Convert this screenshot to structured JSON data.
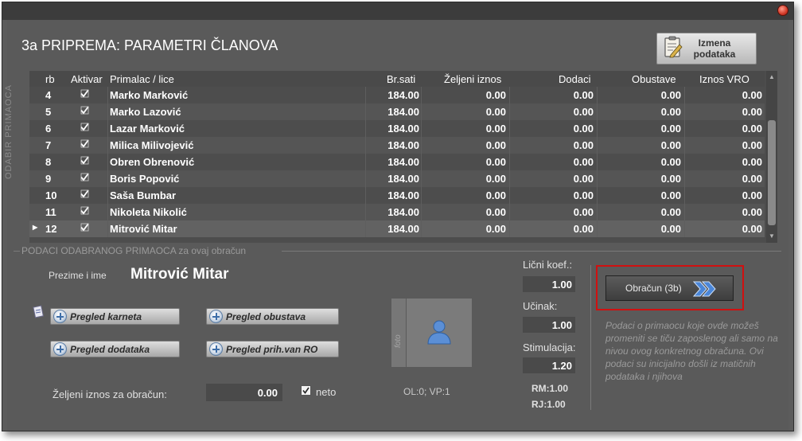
{
  "window": {
    "title": "3a PRIPREMA: PARAMETRI ČLANOVA"
  },
  "toolbar": {
    "edit_button_line1": "Izmena",
    "edit_button_line2": "podataka"
  },
  "grid": {
    "side_label": "ODABIR PRIMAOCA",
    "columns": [
      "rb",
      "Aktivar",
      "Primalac / lice",
      "Br.sati",
      "Željeni iznos",
      "Dodaci",
      "Obustave",
      "Iznos VRO"
    ],
    "rows": [
      {
        "rb": "4",
        "name": "Marko Marković",
        "sati": "184.00",
        "zeljeni": "0.00",
        "dodaci": "0.00",
        "obustave": "0.00",
        "vro": "0.00"
      },
      {
        "rb": "5",
        "name": "Marko Lazović",
        "sati": "184.00",
        "zeljeni": "0.00",
        "dodaci": "0.00",
        "obustave": "0.00",
        "vro": "0.00"
      },
      {
        "rb": "6",
        "name": "Lazar Marković",
        "sati": "184.00",
        "zeljeni": "0.00",
        "dodaci": "0.00",
        "obustave": "0.00",
        "vro": "0.00"
      },
      {
        "rb": "7",
        "name": "Milica Milivojević",
        "sati": "184.00",
        "zeljeni": "0.00",
        "dodaci": "0.00",
        "obustave": "0.00",
        "vro": "0.00"
      },
      {
        "rb": "8",
        "name": "Obren Obrenović",
        "sati": "184.00",
        "zeljeni": "0.00",
        "dodaci": "0.00",
        "obustave": "0.00",
        "vro": "0.00"
      },
      {
        "rb": "9",
        "name": "Boris Popović",
        "sati": "184.00",
        "zeljeni": "0.00",
        "dodaci": "0.00",
        "obustave": "0.00",
        "vro": "0.00"
      },
      {
        "rb": "10",
        "name": "Saša Bumbar",
        "sati": "184.00",
        "zeljeni": "0.00",
        "dodaci": "0.00",
        "obustave": "0.00",
        "vro": "0.00"
      },
      {
        "rb": "11",
        "name": "Nikoleta Nikolić",
        "sati": "184.00",
        "zeljeni": "0.00",
        "dodaci": "0.00",
        "obustave": "0.00",
        "vro": "0.00"
      },
      {
        "rb": "12",
        "name": "Mitrović Mitar",
        "sati": "184.00",
        "zeljeni": "0.00",
        "dodaci": "0.00",
        "obustave": "0.00",
        "vro": "0.00"
      }
    ],
    "selected_row": "12"
  },
  "details": {
    "section_label": "PODACI ODABRANOG PRIMAOCA za ovaj obračun",
    "prezime_label": "Prezime i ime",
    "prezime_value": "Mitrović Mitar",
    "buttons": {
      "karneta": "Pregled karneta",
      "obustava": "Pregled obustava",
      "dodataka": "Pregled dodataka",
      "prihvan": "Pregled prih.van RO"
    },
    "zeljeni_label": "Željeni iznos za obračun:",
    "zeljeni_value": "0.00",
    "neto_label": "neto",
    "foto_label": "foto",
    "ol_vp": "OL:0;  VP:1",
    "licni_koef_label": "Lični koef.:",
    "licni_koef_value": "1.00",
    "ucinak_label": "Učinak:",
    "ucinak_value": "1.00",
    "stimulacija_label": "Stimulacija:",
    "stimulacija_value": "1.20",
    "rm": "RM:1.00",
    "rj": "RJ:1.00",
    "obracun_button": "Obračun (3b)",
    "info_text": "Podaci o primaocu koje ovde možeš promeniti se tiču zaposlenog ali samo na nivou ovog konkretnog obračuna. Ovi podaci su inicijalno došli iz matičnih podataka i njihova"
  },
  "colors": {
    "panel": "#5a5a5a",
    "highlight_frame": "#d01010",
    "accent_arrows": "#4a86d8"
  },
  "icons": {
    "close": "close-icon",
    "edit": "clipboard-edit-icon",
    "add": "plus-circle-icon",
    "person": "person-placeholder-icon",
    "arrows": "double-chevron-right-icon"
  }
}
